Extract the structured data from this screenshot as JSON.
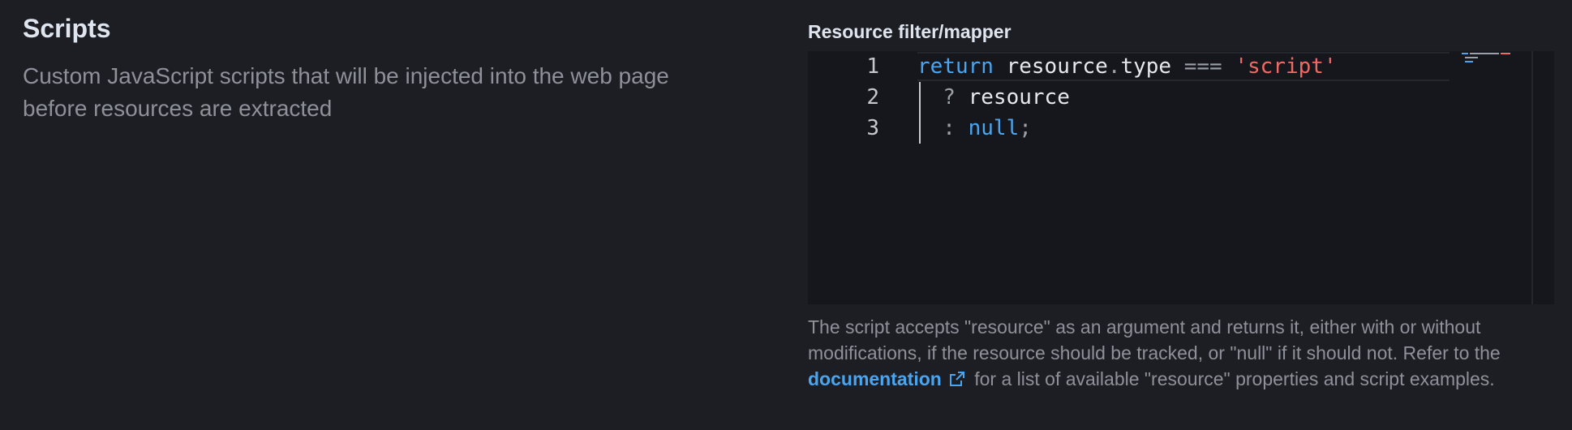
{
  "section": {
    "title": "Scripts",
    "description": "Custom JavaScript scripts that will be injected into the web page before resources are extracted"
  },
  "resource_filter": {
    "label": "Resource filter/mapper",
    "editor": {
      "line_numbers": [
        "1",
        "2",
        "3"
      ],
      "lines": [
        [
          {
            "text": "return",
            "kind": "kw"
          },
          {
            "text": " resource",
            "kind": "id"
          },
          {
            "text": ".",
            "kind": "punct"
          },
          {
            "text": "type",
            "kind": "id"
          },
          {
            "text": " === ",
            "kind": "punct"
          },
          {
            "text": "'script'",
            "kind": "str"
          }
        ],
        [
          {
            "text": "  ? ",
            "kind": "punct"
          },
          {
            "text": "resource",
            "kind": "id"
          }
        ],
        [
          {
            "text": "  : ",
            "kind": "punct"
          },
          {
            "text": "null",
            "kind": "kw"
          },
          {
            "text": ";",
            "kind": "punct"
          }
        ]
      ]
    },
    "help": {
      "text_before": "The script accepts \"resource\" as an argument and returns it, either with or without modifications, if the resource should be tracked, or \"null\" if it should not. Refer to the ",
      "link_label": "documentation",
      "text_after": " for a list of available \"resource\" properties and script examples."
    }
  },
  "colors": {
    "background": "#1d1e24",
    "editor_background": "#16171c",
    "keyword": "#4aa5f0",
    "string": "#f06a65",
    "link": "#4aa5f0"
  },
  "icons": {
    "external_link": "external-link-icon"
  }
}
